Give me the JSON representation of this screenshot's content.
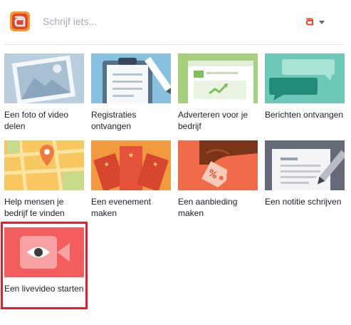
{
  "composer": {
    "placeholder": "Schrijf iets...",
    "brand_color": "#e8422f"
  },
  "account": {
    "icon": "brand-mini-logo-icon",
    "menu_icon": "caret-down-icon"
  },
  "options": [
    {
      "label": "Een foto of video delen",
      "icon": "photo-landscape-icon",
      "color": "#b9cfe0"
    },
    {
      "label": "Registraties ontvangen",
      "icon": "clipboard-pencil-icon",
      "color": "#88c1e0"
    },
    {
      "label": "Adverteren voor je bedrijf",
      "icon": "ad-browser-icon",
      "color": "#a6d07d"
    },
    {
      "label": "Berichten ontvangen",
      "icon": "chat-bubbles-icon",
      "color": "#6dc8b8"
    },
    {
      "label": "Help mensen je bedrijf te vinden",
      "icon": "map-pin-icon",
      "color": "#f6c85f"
    },
    {
      "label": "Een evenement maken",
      "icon": "event-tickets-icon",
      "color": "#f19a3e"
    },
    {
      "label": "Een aanbieding maken",
      "icon": "offer-tag-icon",
      "color": "#f06b4a"
    },
    {
      "label": "Een notitie schrijven",
      "icon": "note-pencil-icon",
      "color": "#646b78"
    },
    {
      "label": "Een livevideo starten",
      "icon": "live-video-camera-icon",
      "color": "#f35d5d",
      "highlighted": true
    }
  ]
}
